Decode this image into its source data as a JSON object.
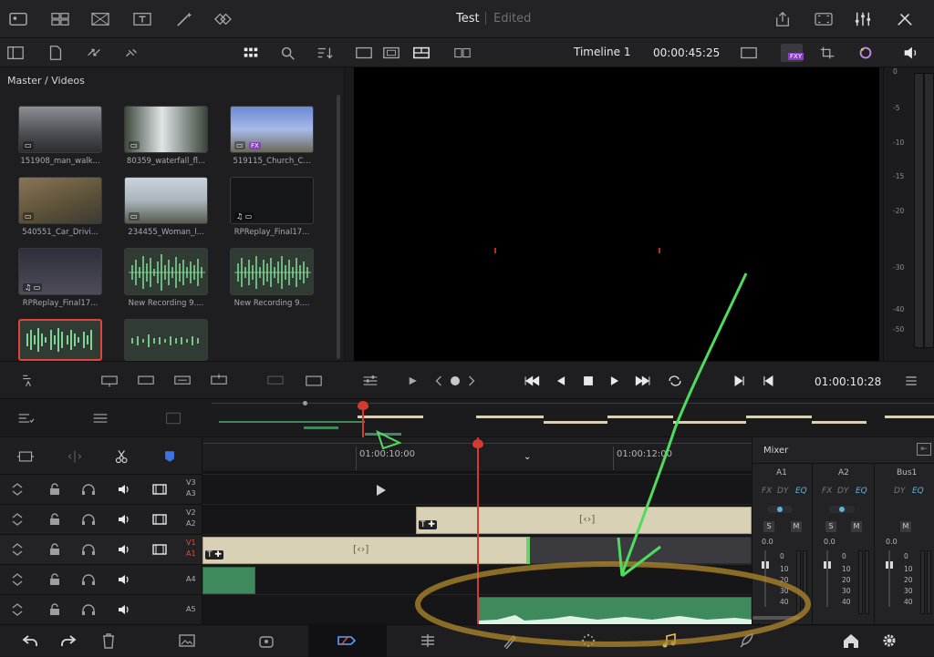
{
  "header": {
    "project_title": "Test",
    "status": "Edited"
  },
  "media_pool": {
    "breadcrumb": "Master / Videos",
    "clips": [
      {
        "name": "151908_man_walk...",
        "kind": "video"
      },
      {
        "name": "80359_waterfall_fl...",
        "kind": "video"
      },
      {
        "name": "519115_Church_C...",
        "kind": "video",
        "fx": "FX"
      },
      {
        "name": "540551_Car_Drivi...",
        "kind": "video"
      },
      {
        "name": "234455_Woman_l...",
        "kind": "video"
      },
      {
        "name": "RPReplay_Final17...",
        "kind": "video"
      },
      {
        "name": "RPReplay_Final17...",
        "kind": "video"
      },
      {
        "name": "New Recording 9....",
        "kind": "audio"
      },
      {
        "name": "New Recording 9....",
        "kind": "audio"
      },
      {
        "name": "",
        "kind": "audio",
        "selected": true
      },
      {
        "name": "",
        "kind": "audio"
      }
    ]
  },
  "viewer": {
    "timeline_name": "Timeline 1",
    "duration": "00:00:45:25",
    "badge": "FXY"
  },
  "meter_scale": [
    "0",
    "-5",
    "-10",
    "-15",
    "-20",
    "-30",
    "-40",
    "-50"
  ],
  "transport": {
    "timecode": "01:00:10:28"
  },
  "ruler": {
    "marks": [
      "01:00:10:00",
      "01:00:12:00"
    ]
  },
  "tracks": [
    {
      "label_top": "V3",
      "label_bottom": "A3"
    },
    {
      "label_top": "V2",
      "label_bottom": "A2"
    },
    {
      "label_top": "V1",
      "label_bottom": "A1"
    },
    {
      "label_top": "",
      "label_bottom": "A4"
    },
    {
      "label_top": "",
      "label_bottom": "A5"
    }
  ],
  "clip_marker": "[‹›]",
  "mixer": {
    "title": "Mixer",
    "channels": [
      {
        "name": "A1",
        "fx": "FX",
        "dy": "DY",
        "eq": "EQ",
        "s": "S",
        "m": "M",
        "level": "0.0"
      },
      {
        "name": "A2",
        "fx": "FX",
        "dy": "DY",
        "eq": "EQ",
        "s": "S",
        "m": "M",
        "level": "0.0"
      },
      {
        "name": "Bus1",
        "dy": "DY",
        "eq": "EQ",
        "m": "M",
        "level": "0.0"
      }
    ],
    "fader_scale": [
      "0",
      "10",
      "20",
      "30",
      "40"
    ]
  },
  "colors": {
    "accent_green": "#3f8a5d",
    "playhead": "#d43b2f",
    "annotation_green": "#4fdc5d",
    "annotation_orange": "#b38a2c"
  }
}
